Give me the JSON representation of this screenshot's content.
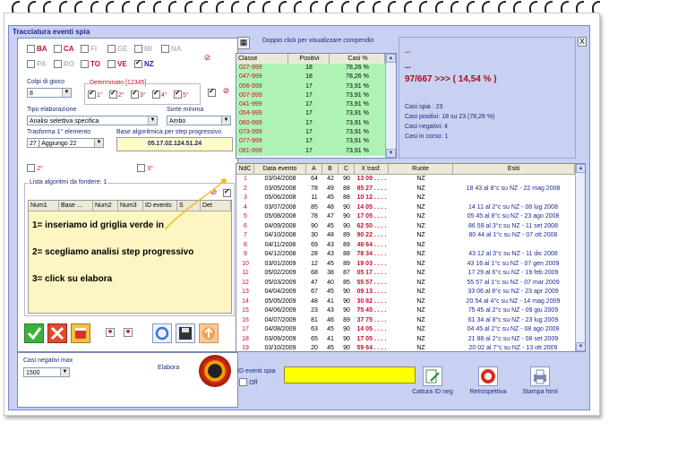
{
  "window": {
    "title": "Tracciatura eventi spia"
  },
  "wheels": [
    {
      "label": "BA",
      "checked": false,
      "style": "red"
    },
    {
      "label": "CA",
      "checked": false,
      "style": "red"
    },
    {
      "label": "FI",
      "checked": false,
      "style": "gray"
    },
    {
      "label": "GE",
      "checked": false,
      "style": "gray"
    },
    {
      "label": "MI",
      "checked": false,
      "style": "gray"
    },
    {
      "label": "NA",
      "checked": false,
      "style": "gray"
    },
    {
      "label": "PA",
      "checked": false,
      "style": "gray"
    },
    {
      "label": "RO",
      "checked": false,
      "style": "gray"
    },
    {
      "label": "TO",
      "checked": false,
      "style": "red"
    },
    {
      "label": "VE",
      "checked": false,
      "style": "red"
    },
    {
      "label": "NZ",
      "checked": true,
      "style": "blue"
    }
  ],
  "colpi": {
    "label": "Colpi di gioco",
    "value": "8"
  },
  "determinato": {
    "label": "Determinato [12345]",
    "items": [
      {
        "label": "1°",
        "checked": true
      },
      {
        "label": "2°",
        "checked": true
      },
      {
        "label": "3°",
        "checked": true
      },
      {
        "label": "4°",
        "checked": true
      },
      {
        "label": "5°",
        "checked": true
      }
    ]
  },
  "tipo": {
    "label": "Tipo elaborazione",
    "value": "Analisi selettiva specifica"
  },
  "sorte": {
    "label": "Sorte minima",
    "value": "Ambo"
  },
  "trasforma": {
    "label": "Trasforma 1° elemento",
    "value": "27 ] Aggiungo 22"
  },
  "base": {
    "label": "Base algoritmica per step progressivo",
    "value": "05.17.02.124.51.24"
  },
  "opt2": {
    "label": "2°"
  },
  "opt3": {
    "label": "3°"
  },
  "lista": {
    "label": "Lista algoritmi da fondere: 1",
    "columns": [
      "Num1",
      "Base ...",
      "Num2",
      "Num3",
      "ID events",
      "S",
      "Det"
    ]
  },
  "notes": [
    "1= inseriamo id griglia verde in",
    "2= scegliamo analisi step progressivo",
    "3= click su elabora"
  ],
  "casi_neg": {
    "label": "Casi negativi max",
    "value": "1500"
  },
  "elabora": {
    "label": "Elabora"
  },
  "classe": {
    "hint": "Doppio click per visualizzare compendio",
    "columns": [
      "Classe",
      "Positivi",
      "Casi %"
    ],
    "rows": [
      {
        "classe": "027-999",
        "pos": "18",
        "pct": "78,26 %"
      },
      {
        "classe": "047-999",
        "pos": "18",
        "pct": "78,26 %"
      },
      {
        "classe": "006-999",
        "pos": "17",
        "pct": "73,91 %"
      },
      {
        "classe": "007-999",
        "pos": "17",
        "pct": "73,91 %"
      },
      {
        "classe": "041-999",
        "pos": "17",
        "pct": "73,91 %"
      },
      {
        "classe": "054-999",
        "pos": "17",
        "pct": "73,91 %"
      },
      {
        "classe": "060-999",
        "pos": "17",
        "pct": "73,91 %"
      },
      {
        "classe": "073-999",
        "pos": "17",
        "pct": "73,91 %"
      },
      {
        "classe": "077-999",
        "pos": "17",
        "pct": "73,91 %"
      },
      {
        "classe": "081-999",
        "pos": "17",
        "pct": "73,91 %"
      }
    ]
  },
  "info": {
    "dots1": "...",
    "dots2": "...",
    "result": "97/667 >>> ( 14,54 % )",
    "spia": "Casi spia : 23",
    "positivi": "Casi positivi: 18 su 23 (78,26 %)",
    "negativi": "Casi negativi: 4",
    "corso": "Casi in corso: 1",
    "close": "X"
  },
  "events": {
    "columns": [
      "NdC",
      "Data evento",
      "A",
      "B",
      "C",
      "X trasf.",
      "Ruote",
      "Esiti"
    ],
    "rows": [
      {
        "ndc": "1",
        "data": "03/04/2008",
        "a": "64",
        "b": "42",
        "c": "90",
        "x": "13 09 . . . .",
        "ruote": "NZ",
        "esiti": ""
      },
      {
        "ndc": "2",
        "data": "03/05/2008",
        "a": "78",
        "b": "49",
        "c": "88",
        "x": "85 27 . . . .",
        "ruote": "NZ",
        "esiti": "18 43 al 8°c su NZ - 22 mag 2008"
      },
      {
        "ndc": "3",
        "data": "05/06/2008",
        "a": "11",
        "b": "45",
        "c": "88",
        "x": "10 12 . . . .",
        "ruote": "NZ",
        "esiti": ""
      },
      {
        "ndc": "4",
        "data": "03/07/2008",
        "a": "85",
        "b": "48",
        "c": "90",
        "x": "14 05 . . . .",
        "ruote": "NZ",
        "esiti": "14 11 al 2°c su NZ - 08 lug 2008"
      },
      {
        "ndc": "5",
        "data": "05/08/2008",
        "a": "78",
        "b": "47",
        "c": "90",
        "x": "17 05 . . . .",
        "ruote": "NZ",
        "esiti": "05 45 al 8°c su NZ - 23 ago 2008"
      },
      {
        "ndc": "6",
        "data": "04/09/2008",
        "a": "90",
        "b": "45",
        "c": "90",
        "x": "62 50 . . . .",
        "ruote": "NZ",
        "esiti": "86 59 al 3°c su NZ - 11 set 2008"
      },
      {
        "ndc": "7",
        "data": "04/10/2008",
        "a": "30",
        "b": "48",
        "c": "89",
        "x": "90 22 . . . .",
        "ruote": "NZ",
        "esiti": "80 44 al 1°c su NZ - 07 ott 2008"
      },
      {
        "ndc": "8",
        "data": "04/11/2008",
        "a": "69",
        "b": "43",
        "c": "89",
        "x": "48 64 . . . .",
        "ruote": "NZ",
        "esiti": ""
      },
      {
        "ndc": "9",
        "data": "04/12/2008",
        "a": "28",
        "b": "43",
        "c": "88",
        "x": "78 34 . . . .",
        "ruote": "NZ",
        "esiti": "43 12 al 3°c su NZ - 11 dic 2008"
      },
      {
        "ndc": "10",
        "data": "03/01/2009",
        "a": "12",
        "b": "45",
        "c": "89",
        "x": "19 03 . . . .",
        "ruote": "NZ",
        "esiti": "43 16 al 1°c su NZ - 07 gen 2009"
      },
      {
        "ndc": "11",
        "data": "05/02/2009",
        "a": "68",
        "b": "38",
        "c": "87",
        "x": "05 17 . . . .",
        "ruote": "NZ",
        "esiti": "17 29 al 6°c su NZ - 19 feb 2009"
      },
      {
        "ndc": "12",
        "data": "05/03/2009",
        "a": "47",
        "b": "40",
        "c": "85",
        "x": "55 57 . . . .",
        "ruote": "NZ",
        "esiti": "55 57 al 1°c su NZ - 07 mar 2009"
      },
      {
        "ndc": "13",
        "data": "04/04/2009",
        "a": "67",
        "b": "45",
        "c": "90",
        "x": "09 13 . . . .",
        "ruote": "NZ",
        "esiti": "33 06 al 8°c su NZ - 23 apr 2009"
      },
      {
        "ndc": "14",
        "data": "05/05/2009",
        "a": "48",
        "b": "41",
        "c": "90",
        "x": "30 82 . . . .",
        "ruote": "NZ",
        "esiti": "20 54 al 4°c su NZ - 14 mag 2009"
      },
      {
        "ndc": "15",
        "data": "04/06/2009",
        "a": "23",
        "b": "43",
        "c": "90",
        "x": "75 45 . . . .",
        "ruote": "NZ",
        "esiti": "75 45 al 2°c su NZ - 09 giu 2009"
      },
      {
        "ndc": "16",
        "data": "04/07/2009",
        "a": "81",
        "b": "46",
        "c": "89",
        "x": "37 75 . . . .",
        "ruote": "NZ",
        "esiti": "61 34 al 8°c su NZ - 23 lug 2009"
      },
      {
        "ndc": "17",
        "data": "04/08/2009",
        "a": "63",
        "b": "45",
        "c": "90",
        "x": "14 05 . . . .",
        "ruote": "NZ",
        "esiti": "04 45 al 2°c su NZ - 08 ago 2009"
      },
      {
        "ndc": "18",
        "data": "03/09/2009",
        "a": "65",
        "b": "41",
        "c": "90",
        "x": "17 05 . . . .",
        "ruote": "NZ",
        "esiti": "21 88 al 2°c su NZ - 08 set 2009"
      },
      {
        "ndc": "19",
        "data": "03/10/2009",
        "a": "20",
        "b": "45",
        "c": "90",
        "x": "59 64 . . . .",
        "ruote": "NZ",
        "esiti": "20 02 al 7°c su NZ - 13 ott 2009"
      }
    ]
  },
  "footer": {
    "id_label": "ID eventi spia",
    "off_label": "Off",
    "cattura": "Cattura ID neg",
    "retro": "Retrospettiva",
    "stampa": "Stampa html"
  },
  "colors": {
    "window": "#c9d1f2",
    "green": "#aef3b4",
    "yellow": "#ffff00",
    "red": "#c8102e",
    "blue": "#1a2a9a"
  }
}
